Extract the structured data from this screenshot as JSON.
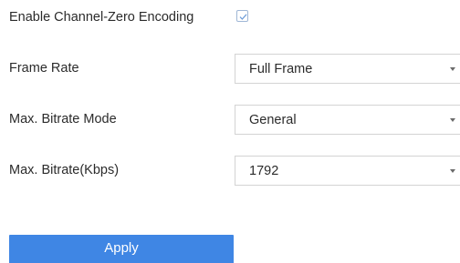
{
  "encoding": {
    "enable_label": "Enable Channel-Zero Encoding",
    "enable_checked": true
  },
  "frame_rate": {
    "label": "Frame Rate",
    "value": "Full Frame"
  },
  "bitrate_mode": {
    "label": "Max. Bitrate Mode",
    "value": "General"
  },
  "bitrate": {
    "label": "Max. Bitrate(Kbps)",
    "value": "1792"
  },
  "actions": {
    "apply_label": "Apply"
  },
  "colors": {
    "accent": "#3f86e4",
    "checkbox_border": "#9fb7d6",
    "field_border": "#d3d3d3",
    "text": "#2b2b2b"
  },
  "icons": {
    "checkbox": "check-icon",
    "dropdown": "caret-down-icon"
  }
}
